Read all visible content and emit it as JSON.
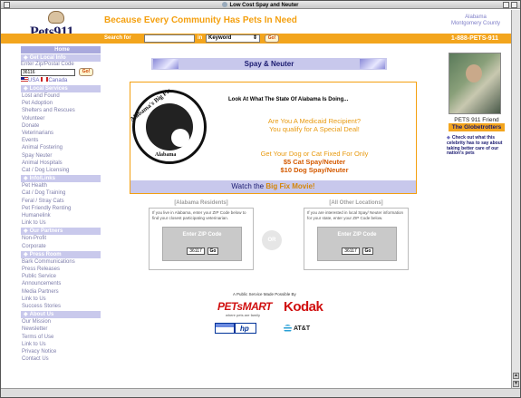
{
  "window": {
    "title": "Low Cost Spay and Neuter"
  },
  "header": {
    "logo_text": "Pets911",
    "tagline": "Because Every Community Has Pets In Need",
    "region_line1": "Alabama",
    "region_line2": "Montgomery County"
  },
  "navbar": {
    "search_label": "Search for",
    "search_value": "",
    "in_label": "in",
    "search_scope": "Keyword",
    "go_label": "Go!",
    "phone": "1-888-PETS-911"
  },
  "sidebar": {
    "home": "Home",
    "local_info_header": "Get Local Info",
    "zip_label": "Enter Zip/Postal Code",
    "zip_value": "36116",
    "zip_go": "Go!",
    "country_us": "USA",
    "country_ca": "Canada",
    "local_services_header": "Local Services",
    "local_services": [
      "Lost and Found",
      "Pet Adoption",
      "Shelters and Rescues",
      "Volunteer",
      "Donate",
      "Veterinarians",
      "Events",
      "Animal Fostering",
      "Spay Neuter",
      "Animal Hospitals",
      "Cat / Dog Licensing"
    ],
    "info_links_header": "Info/Links",
    "info_links": [
      "Pet Health",
      "Cat / Dog Training",
      "Feral / Stray Cats",
      "Pet Friendly Renting",
      "Humanelink",
      "Link to Us"
    ],
    "partners_header": "Our Partners",
    "partners": [
      "Non-Profit",
      "Corporate"
    ],
    "press_header": "Press Room",
    "press": [
      "Bark Communications",
      "Press Releases",
      "Public Service",
      "Announcements",
      "Media Partners",
      "Link to Us",
      "Success Stories"
    ],
    "about_header": "About Us",
    "about": [
      "Our Mission",
      "Newsletter",
      "Terms of Use",
      "Link to Us",
      "Privacy Notice",
      "Contact Us"
    ]
  },
  "main": {
    "banner_title": "Spay & Neuter",
    "seal_top": "Alabama's Big Fix",
    "seal_bottom": "Alabama",
    "look_text": "Look At What The State Of Alabama Is Doing...",
    "medicaid_line1": "Are You A Medicaid Recipient?",
    "medicaid_line2": "You qualify for A Special Deal!",
    "fix_line1": "Get Your Dog or Cat Fixed For Only",
    "fix_cat": "$5 Cat Spay/Neuter",
    "fix_dog": "$10 Dog Spay/Neuter",
    "movie_prefix": "Watch the ",
    "movie_link": "Big Fix Movie!",
    "panel_left_title": "[Alabama Residents]",
    "panel_left_text": "If you live in Alabama, enter your ZIP Code below to find your closest participating veterinarian.",
    "panel_right_title": "[All Other Locations]",
    "panel_right_text": "If you are interested in local Spay/ Neuter information for your state, enter your ZIP Code below.",
    "enter_zip": "Enter ZIP Code",
    "zip_value": "36117",
    "go": "Go",
    "or": "OR",
    "sponsor_header": "A Public Service Made Possible By",
    "petsmart": "PETsMART",
    "petsmart_tag": "where pets are family",
    "kodak": "Kodak",
    "hp_logo": "hp",
    "att": "AT&T"
  },
  "right": {
    "caption1": "PETS 911 Friend",
    "caption2": "The Globetrotters",
    "promo_text": "Check out what this celebrity has to say about taking better care of our nation's pets"
  }
}
